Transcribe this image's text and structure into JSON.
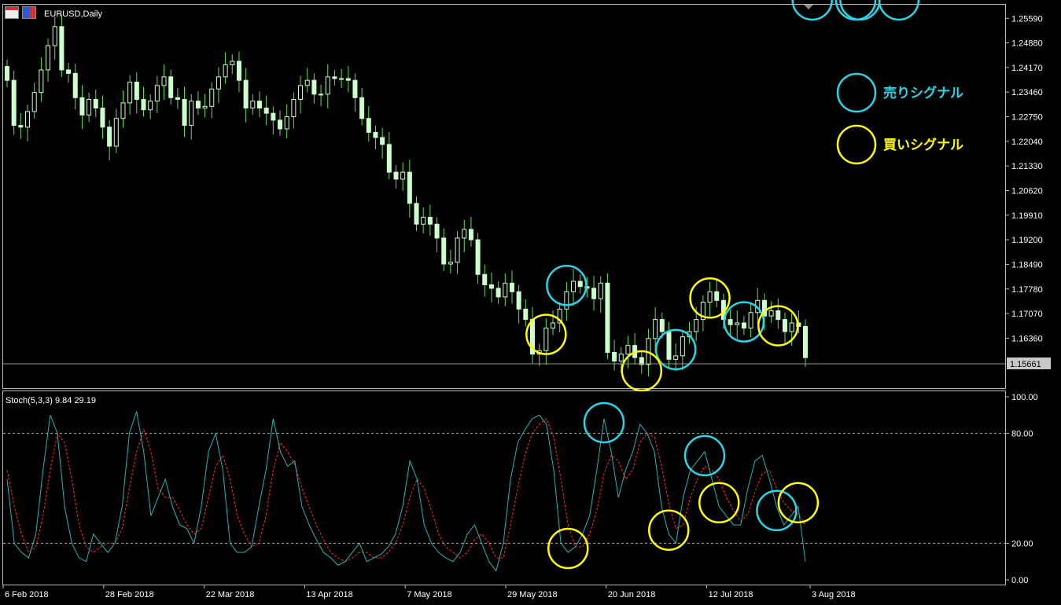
{
  "header": {
    "symbol_label": "EURUSD,Daily"
  },
  "indicator": {
    "label": "Stoch(5,3,3) 9.84 29.19"
  },
  "legend": {
    "sell": "売りシグナル",
    "buy": "買いシグナル",
    "sell_color": "#29d6e6",
    "buy_color": "#ffff00"
  },
  "colors": {
    "bg": "#000000",
    "bull": "#ccffcc",
    "wick": "#66dd55",
    "k_line": "#2ab3b3",
    "d_line": "#ff2a2a",
    "circle_sell": "#29d6e6",
    "circle_buy": "#ffff00"
  },
  "current_price": "1.15661",
  "chart_data": [
    {
      "type": "candlestick",
      "title": "EURUSD,Daily",
      "y_ticks": [
        "1.25590",
        "1.24880",
        "1.24170",
        "1.23460",
        "1.22750",
        "1.22040",
        "1.21330",
        "1.20620",
        "1.19910",
        "1.19200",
        "1.18490",
        "1.17780",
        "1.17070",
        "1.16360"
      ],
      "ylim": [
        1.151,
        1.258
      ],
      "last_price": 1.15661,
      "x_labels": [
        "6 Feb 2018",
        "28 Feb 2018",
        "22 Mar 2018",
        "13 Apr 2018",
        "7 May 2018",
        "29 May 2018",
        "20 Jun 2018",
        "12 Jul 2018",
        "3 Aug 2018"
      ],
      "closes": [
        1.238,
        1.225,
        1.2245,
        1.229,
        1.2345,
        1.241,
        1.248,
        1.2535,
        1.241,
        1.24,
        1.233,
        1.228,
        1.2325,
        1.23,
        1.2245,
        1.219,
        1.227,
        1.2315,
        1.2375,
        1.2325,
        1.2295,
        1.232,
        1.2365,
        1.239,
        1.233,
        1.2325,
        1.225,
        1.232,
        1.23,
        1.2305,
        1.2355,
        1.239,
        1.2425,
        1.2435,
        1.238,
        1.23,
        1.232,
        1.23,
        1.2285,
        1.2265,
        1.224,
        1.2275,
        1.2325,
        1.2365,
        1.238,
        1.234,
        1.234,
        1.239,
        1.2385,
        1.2385,
        1.238,
        1.233,
        1.227,
        1.223,
        1.2215,
        1.2195,
        1.2115,
        1.2095,
        1.2115,
        1.2025,
        1.1965,
        1.1985,
        1.1965,
        1.1925,
        1.185,
        1.1855,
        1.1925,
        1.195,
        1.192,
        1.182,
        1.179,
        1.178,
        1.1755,
        1.1795,
        1.177,
        1.172,
        1.169,
        1.159,
        1.16,
        1.1665,
        1.168,
        1.172,
        1.177,
        1.18,
        1.1785,
        1.178,
        1.175,
        1.1795,
        1.1595,
        1.157,
        1.159,
        1.1615,
        1.158,
        1.156,
        1.1635,
        1.169,
        1.1655,
        1.1575,
        1.1585,
        1.164,
        1.1655,
        1.169,
        1.174,
        1.177,
        1.1745,
        1.169,
        1.1675,
        1.168,
        1.1665,
        1.171,
        1.1745,
        1.17,
        1.1715,
        1.169,
        1.1655,
        1.168,
        1.167,
        1.158
      ]
    },
    {
      "type": "line",
      "title": "Stoch(5,3,3) 9.84 29.19",
      "y_ticks": [
        "100.00",
        "80.00",
        "20.00",
        "0.00"
      ],
      "ylim": [
        0,
        100
      ],
      "levels": [
        80,
        20
      ],
      "series": [
        {
          "values": [
            55,
            20,
            15,
            12,
            25,
            60,
            90,
            80,
            40,
            20,
            12,
            10,
            25,
            20,
            15,
            20,
            40,
            80,
            92,
            70,
            35,
            45,
            55,
            40,
            30,
            28,
            20,
            40,
            70,
            80,
            60,
            20,
            15,
            15,
            18,
            40,
            60,
            88,
            70,
            62,
            65,
            40,
            30,
            22,
            15,
            12,
            8,
            10,
            15,
            20,
            10,
            12,
            14,
            18,
            25,
            40,
            65,
            55,
            30,
            20,
            15,
            12,
            10,
            15,
            25,
            30,
            20,
            10,
            5,
            20,
            55,
            75,
            82,
            88,
            90,
            85,
            60,
            20,
            15,
            18,
            25,
            35,
            60,
            88,
            70,
            45,
            60,
            70,
            85,
            80,
            70,
            40,
            25,
            20,
            45,
            60,
            65,
            70,
            55,
            40,
            35,
            30,
            30,
            50,
            65,
            68,
            55,
            40,
            30,
            35,
            40,
            10
          ]
        },
        {
          "values": [
            60,
            40,
            25,
            15,
            18,
            35,
            60,
            80,
            75,
            55,
            30,
            18,
            15,
            18,
            20,
            20,
            28,
            50,
            70,
            82,
            70,
            50,
            45,
            45,
            38,
            30,
            25,
            28,
            45,
            62,
            68,
            55,
            35,
            25,
            18,
            20,
            35,
            60,
            75,
            70,
            63,
            50,
            40,
            30,
            22,
            15,
            12,
            10,
            12,
            15,
            15,
            12,
            12,
            15,
            20,
            30,
            45,
            55,
            50,
            38,
            25,
            18,
            15,
            12,
            15,
            22,
            25,
            20,
            12,
            12,
            30,
            50,
            68,
            80,
            85,
            88,
            78,
            55,
            30,
            18,
            18,
            25,
            38,
            58,
            68,
            65,
            55,
            60,
            75,
            80,
            78,
            62,
            42,
            28,
            30,
            45,
            55,
            62,
            60,
            55,
            45,
            38,
            32,
            36,
            48,
            58,
            60,
            50,
            42,
            38,
            36,
            30
          ]
        }
      ],
      "x_labels": [
        "6 Feb 2018",
        "28 Feb 2018",
        "22 Mar 2018",
        "13 Apr 2018",
        "7 May 2018",
        "29 May 2018",
        "20 Jun 2018",
        "12 Jul 2018",
        "3 Aug 2018"
      ]
    }
  ],
  "signals": {
    "price_sell_idx": [
      82,
      98,
      108,
      118,
      125
    ],
    "price_buy_idx": [
      79,
      93,
      103,
      113
    ],
    "stoch_sell_idx": [
      83,
      97,
      107,
      118,
      124
    ],
    "stoch_buy_idx": [
      78,
      92,
      99,
      110
    ]
  }
}
